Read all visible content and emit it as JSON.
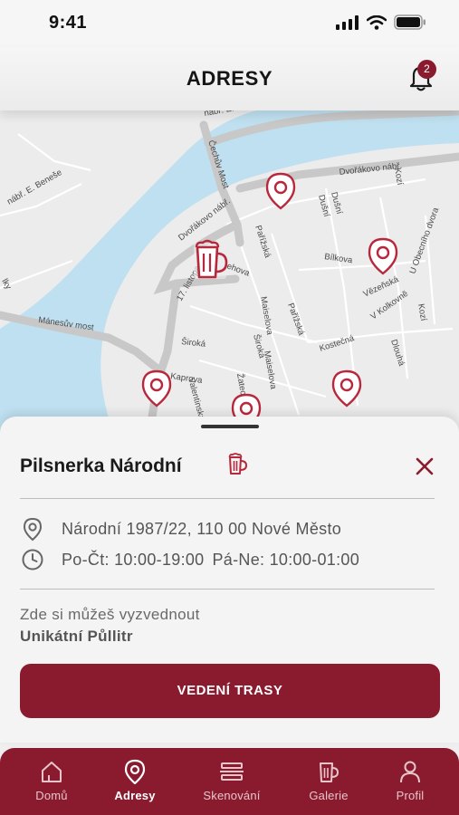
{
  "status_bar": {
    "time": "9:41"
  },
  "header": {
    "title": "ADRESY",
    "notification_count": "2"
  },
  "map": {
    "labels": {
      "narodni_e_benese_top": "nábř. E. Beneše",
      "narodni_e_benese_left": "nábř. E. Beneše",
      "cechuv_most": "Čechův Most",
      "dvorakovo_nabr": "Dvořákovo nábř.",
      "dvorakovo_nabr_2": "Dvořákovo nábř.",
      "kozi": "Kozí",
      "dusni_1": "Dušní",
      "dusni_2": "Dušní",
      "parizska": "Pařížská",
      "parizska_2": "Pařížská",
      "bilkova": "Bílkova",
      "listopadu": "17. listopadu",
      "valentinska": "Valentinská",
      "maiselova": "Maiselova",
      "maiselova_2": "Maiselova",
      "siroka": "Široká",
      "siroka_2": "Široká",
      "kaprova": "Kaprova",
      "manesuv_most": "Mánesův most",
      "vezenska": "Vězeňská",
      "v_kolkovne": "V Kolkovně",
      "kostecna": "Kostečná",
      "dlouha": "Dlouhá",
      "u_obecniho": "U Obecního dvora",
      "zatecka": "Žatecká",
      "ehova": "ehova",
      "kozi_2": "Kozí",
      "ska": "ský",
      "ne": "ne",
      "lky": "lky"
    }
  },
  "place": {
    "name": "Pilsnerka Národní",
    "address": "Národní 1987/22, 110 00 Nové Město",
    "hours_a": "Po-Čt: 10:00-19:00",
    "hours_b": "Pá-Ne: 10:00-01:00",
    "pickup_label": "Zde si můžeš vyzvednout",
    "pickup_item": "Unikátní Půllitr",
    "route_button": "VEDENÍ TRASY"
  },
  "tabs": [
    {
      "label": "Domů",
      "icon": "home-icon"
    },
    {
      "label": "Adresy",
      "icon": "location-pin-icon"
    },
    {
      "label": "Skenování",
      "icon": "scan-icon"
    },
    {
      "label": "Galerie",
      "icon": "beer-mug-icon"
    },
    {
      "label": "Profil",
      "icon": "user-icon"
    }
  ],
  "colors": {
    "brand": "#8a1b2e",
    "river": "#bfe0f0",
    "map_bg": "#ececec"
  }
}
